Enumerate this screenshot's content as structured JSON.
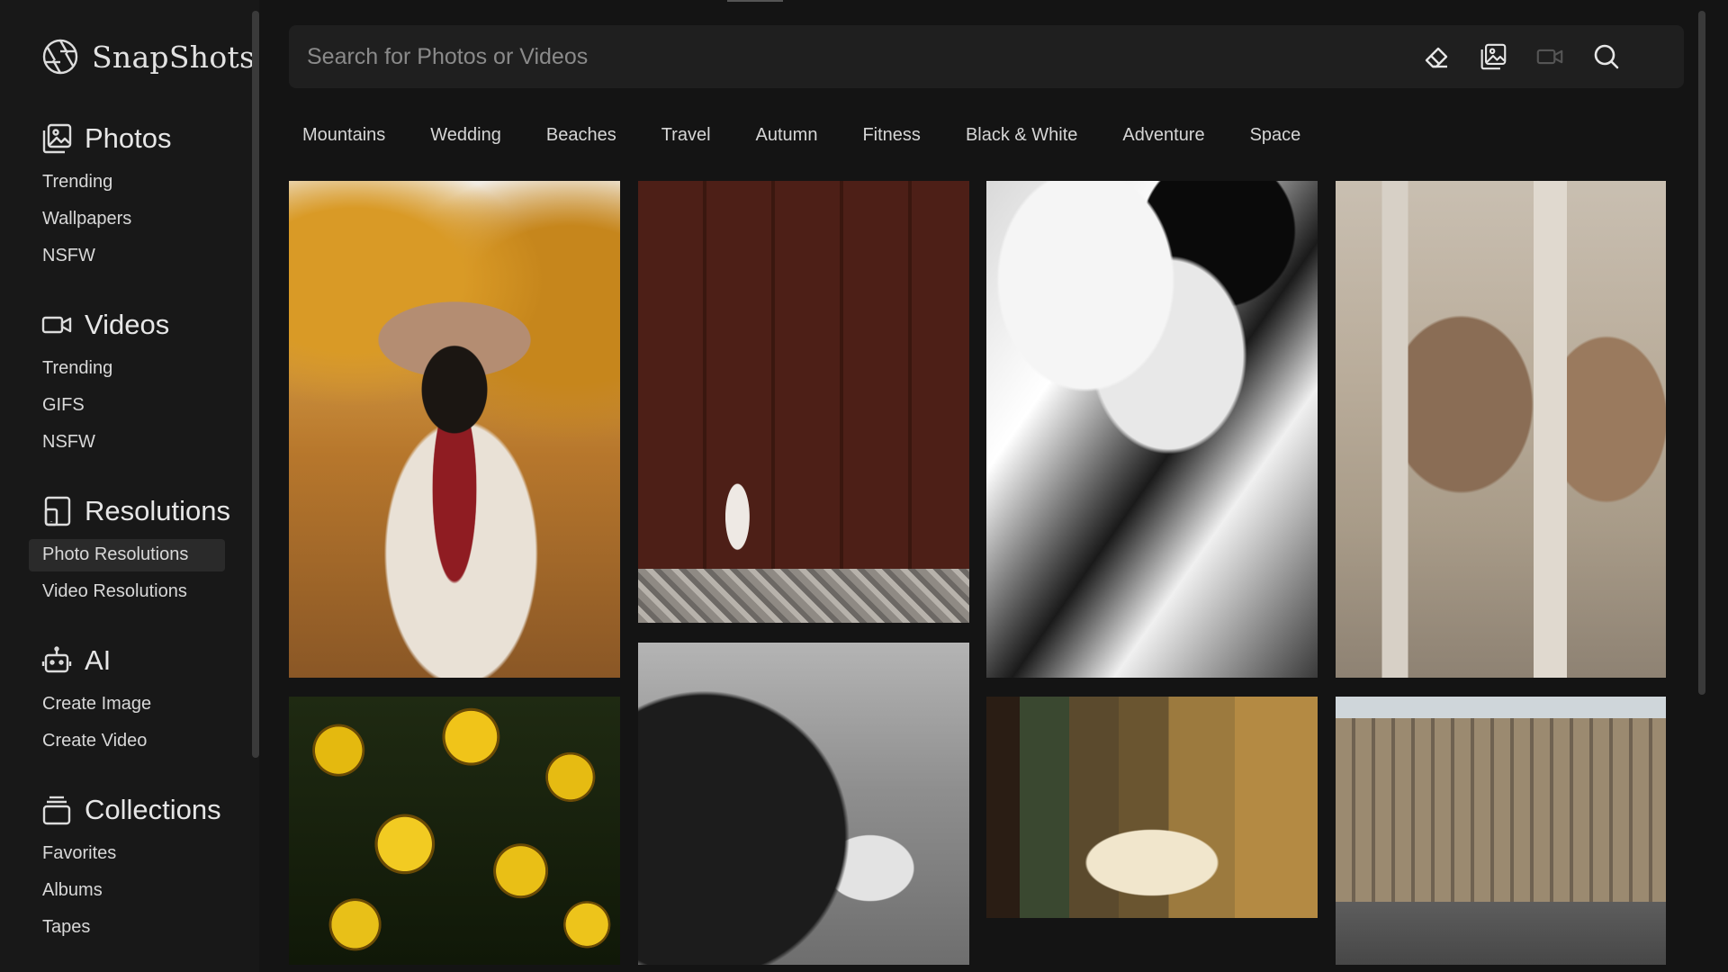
{
  "app": {
    "name": "SnapShots"
  },
  "sidebar": {
    "sections": [
      {
        "title": "Photos",
        "icon": "photos-icon",
        "items": [
          "Trending",
          "Wallpapers",
          "NSFW"
        ]
      },
      {
        "title": "Videos",
        "icon": "video-camera-icon",
        "items": [
          "Trending",
          "GIFS",
          "NSFW"
        ]
      },
      {
        "title": "Resolutions",
        "icon": "device-resolution-icon",
        "items": [
          "Photo Resolutions",
          "Video Resolutions"
        ],
        "active_item": "Photo Resolutions"
      },
      {
        "title": "AI",
        "icon": "robot-icon",
        "items": [
          "Create Image",
          "Create Video"
        ]
      },
      {
        "title": "Collections",
        "icon": "collections-icon",
        "items": [
          "Favorites",
          "Albums",
          "Tapes"
        ]
      }
    ]
  },
  "search": {
    "placeholder": "Search for Photos or Videos",
    "value": "",
    "buttons": [
      "eraser-icon",
      "image-search-icon",
      "video-search-icon",
      "search-icon"
    ]
  },
  "categories": [
    "Mountains",
    "Wedding",
    "Beaches",
    "Travel",
    "Autumn",
    "Fitness",
    "Black & White",
    "Adventure",
    "Space"
  ],
  "gallery": {
    "tiles": [
      "autumn-portrait-photo",
      "rust-wall-photo",
      "black-white-portrait-photo",
      "stone-arch-photo",
      "yellow-flowers-photo",
      "horse-photo",
      "vintage-room-photo",
      "city-street-photo"
    ]
  },
  "colors": {
    "background": "#141414",
    "sidebar": "#181818",
    "searchbar": "#1f1f1f",
    "active_item": "#2a2a2a",
    "text": "#e6e6e6"
  }
}
